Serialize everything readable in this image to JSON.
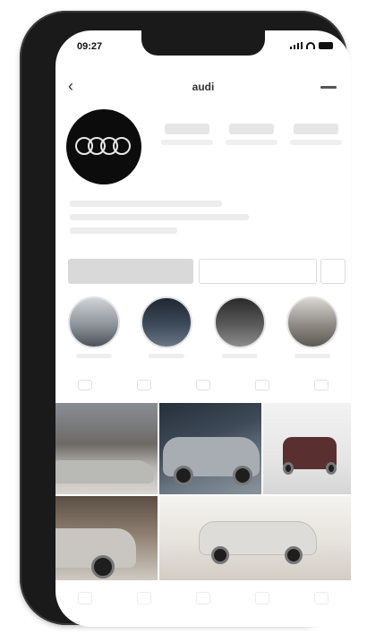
{
  "status_bar": {
    "time": "09:27",
    "icons": [
      "signal-icon",
      "wifi-icon",
      "battery-icon"
    ]
  },
  "profile_header": {
    "username": "audi",
    "back_icon": "chevron-left-icon",
    "menu_icon": "menu-icon"
  },
  "avatar": {
    "logo": "four-rings-logo",
    "colors": {
      "background": "#0c0c0c",
      "rings": "#e8e8e8"
    }
  },
  "stats": [
    {
      "id": "posts"
    },
    {
      "id": "followers"
    },
    {
      "id": "following"
    }
  ],
  "actions": {
    "follow_color": "#d9d9d9",
    "more_icon": "chevron-down-icon"
  },
  "highlights": [
    {
      "id": "highlight-1"
    },
    {
      "id": "highlight-2"
    },
    {
      "id": "highlight-3"
    },
    {
      "id": "highlight-4"
    }
  ],
  "profile_tabs": [
    "grid-icon",
    "reels-icon",
    "video-icon",
    "guide-icon",
    "tagged-icon"
  ],
  "bottom_nav": [
    "home-icon",
    "search-icon",
    "add-icon",
    "shop-icon",
    "profile-icon"
  ]
}
